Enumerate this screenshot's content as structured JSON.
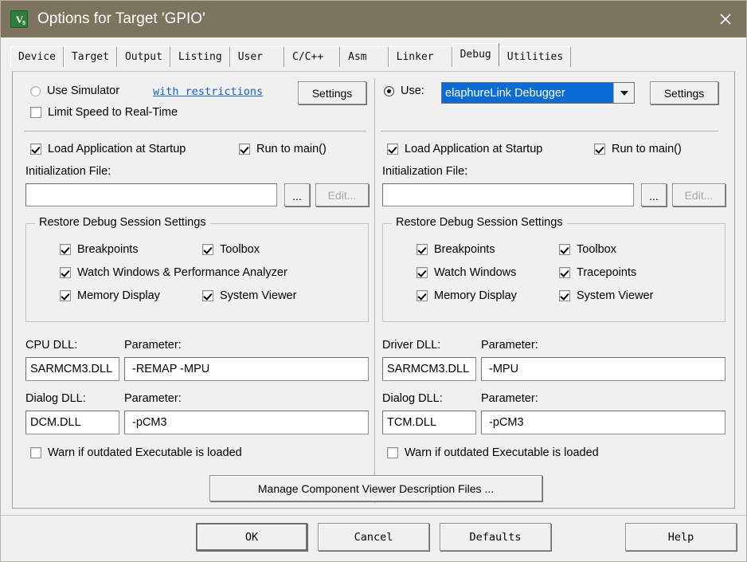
{
  "window": {
    "title": "Options for Target 'GPIO'",
    "icon": "keil-uvision-v5-icon",
    "close_glyph": "✕",
    "titlebar_color": "#7d7460",
    "accent_color": "#0a6cd4",
    "link_color": "#1360c8"
  },
  "tabs": [
    {
      "label": "Device",
      "active": false
    },
    {
      "label": "Target",
      "active": false
    },
    {
      "label": "Output",
      "active": false
    },
    {
      "label": "Listing",
      "active": false
    },
    {
      "label": "User",
      "active": false
    },
    {
      "label": "C/C++",
      "active": false
    },
    {
      "label": "Asm",
      "active": false
    },
    {
      "label": "Linker",
      "active": false
    },
    {
      "label": "Debug",
      "active": true
    },
    {
      "label": "Utilities",
      "active": false
    }
  ],
  "left_pane": {
    "use_simulator_label": "Use Simulator",
    "use_simulator_checked": false,
    "with_restrictions_link": "with restrictions",
    "settings_button": "Settings",
    "limit_speed_label": "Limit Speed to Real-Time",
    "limit_speed_checked": false,
    "load_app_label": "Load Application at Startup",
    "load_app_checked": true,
    "run_to_main_label": "Run to main()",
    "run_to_main_checked": true,
    "init_file_label": "Initialization File:",
    "init_file_value": "",
    "browse_button": "...",
    "edit_button": "Edit...",
    "restore_group_title": "Restore Debug Session Settings",
    "restore_items": [
      {
        "label": "Breakpoints",
        "checked": true
      },
      {
        "label": "Toolbox",
        "checked": true
      },
      {
        "label": "Watch Windows & Performance Analyzer",
        "checked": true
      },
      {
        "label": "Memory Display",
        "checked": true
      },
      {
        "label": "System Viewer",
        "checked": true
      }
    ],
    "cpu_dll_label": "CPU DLL:",
    "cpu_dll_value": "SARMCM3.DLL",
    "cpu_param_label": "Parameter:",
    "cpu_param_value": "-REMAP -MPU",
    "dialog_dll_label": "Dialog DLL:",
    "dialog_dll_value": "DCM.DLL",
    "dialog_param_label": "Parameter:",
    "dialog_param_value": "-pCM3",
    "warn_outdated_label": "Warn if outdated Executable is loaded",
    "warn_outdated_checked": false
  },
  "right_pane": {
    "use_label": "Use:",
    "use_checked": true,
    "debugger_selected": "elaphureLink Debugger",
    "settings_button": "Settings",
    "load_app_label": "Load Application at Startup",
    "load_app_checked": true,
    "run_to_main_label": "Run to main()",
    "run_to_main_checked": true,
    "init_file_label": "Initialization File:",
    "init_file_value": "",
    "browse_button": "...",
    "edit_button": "Edit...",
    "restore_group_title": "Restore Debug Session Settings",
    "restore_items": [
      {
        "label": "Breakpoints",
        "checked": true
      },
      {
        "label": "Toolbox",
        "checked": true
      },
      {
        "label": "Watch Windows",
        "checked": true
      },
      {
        "label": "Tracepoints",
        "checked": true
      },
      {
        "label": "Memory Display",
        "checked": true
      },
      {
        "label": "System Viewer",
        "checked": true
      }
    ],
    "driver_dll_label": "Driver DLL:",
    "driver_dll_value": "SARMCM3.DLL",
    "driver_param_label": "Parameter:",
    "driver_param_value": "-MPU",
    "dialog_dll_label": "Dialog DLL:",
    "dialog_dll_value": "TCM.DLL",
    "dialog_param_label": "Parameter:",
    "dialog_param_value": "-pCM3",
    "warn_outdated_label": "Warn if outdated Executable is loaded",
    "warn_outdated_checked": false
  },
  "manage_button": "Manage Component Viewer Description Files ...",
  "footer": {
    "ok": "OK",
    "cancel": "Cancel",
    "defaults": "Defaults",
    "help": "Help"
  }
}
